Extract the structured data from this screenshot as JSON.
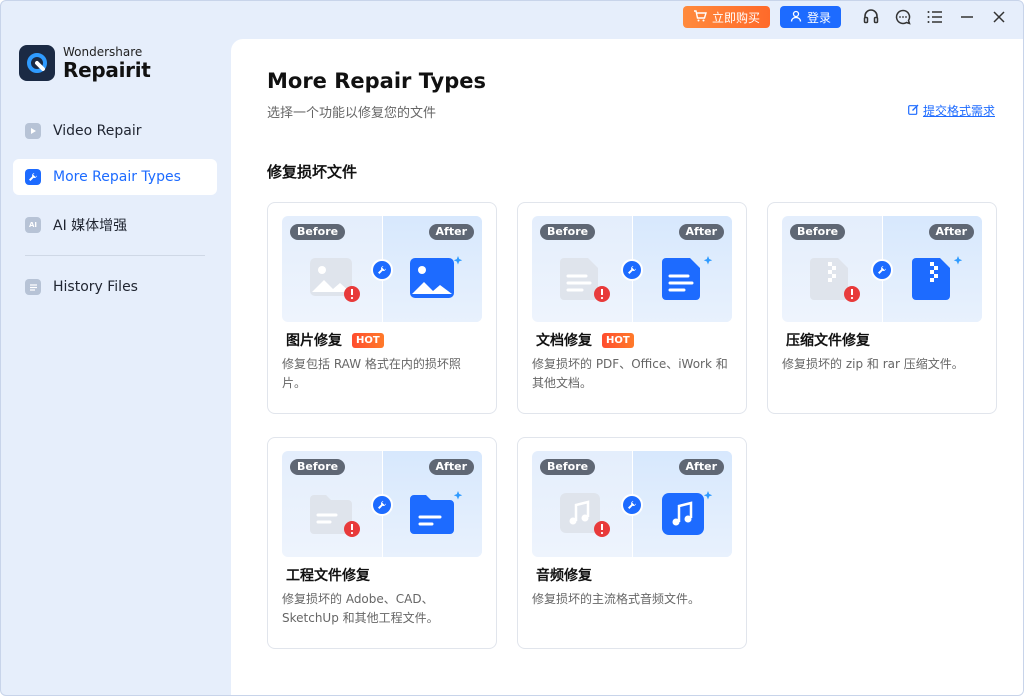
{
  "titlebar": {
    "buy_label": "立即购买",
    "login_label": "登录",
    "icons": [
      "headset-icon",
      "chat-icon",
      "menu-icon",
      "minimize-icon",
      "close-icon"
    ]
  },
  "logo": {
    "small": "Wondershare",
    "big": "Repairit"
  },
  "sidebar": {
    "items": [
      {
        "label": "Video Repair",
        "icon": "video-icon"
      },
      {
        "label": "More Repair Types",
        "icon": "wrench-icon",
        "active": true
      },
      {
        "label": "AI 媒体增强",
        "icon": "ai-icon"
      },
      {
        "label": "History Files",
        "icon": "history-icon"
      }
    ]
  },
  "main": {
    "title": "More Repair Types",
    "subtitle": "选择一个功能以修复您的文件",
    "submit_link": "提交格式需求",
    "section_title": "修复损坏文件",
    "before_label": "Before",
    "after_label": "After",
    "hot_label": "HOT",
    "cards": [
      {
        "title": "图片修复",
        "hot": true,
        "desc": "修复包括 RAW 格式在内的损坏照片。",
        "icon": "image-icon"
      },
      {
        "title": "文档修复",
        "hot": true,
        "desc": "修复损坏的 PDF、Office、iWork 和其他文档。",
        "icon": "document-icon"
      },
      {
        "title": "压缩文件修复",
        "hot": false,
        "desc": "修复损坏的 zip 和 rar 压缩文件。",
        "icon": "zip-icon"
      },
      {
        "title": "工程文件修复",
        "hot": false,
        "desc": "修复损坏的 Adobe、CAD、SketchUp 和其他工程文件。",
        "icon": "folder-icon"
      },
      {
        "title": "音频修复",
        "hot": false,
        "desc": "修复损坏的主流格式音频文件。",
        "icon": "audio-icon"
      }
    ]
  },
  "colors": {
    "accent": "#1d6bff",
    "buy": "#ff7a2a",
    "hot": "#ff4d2e"
  }
}
